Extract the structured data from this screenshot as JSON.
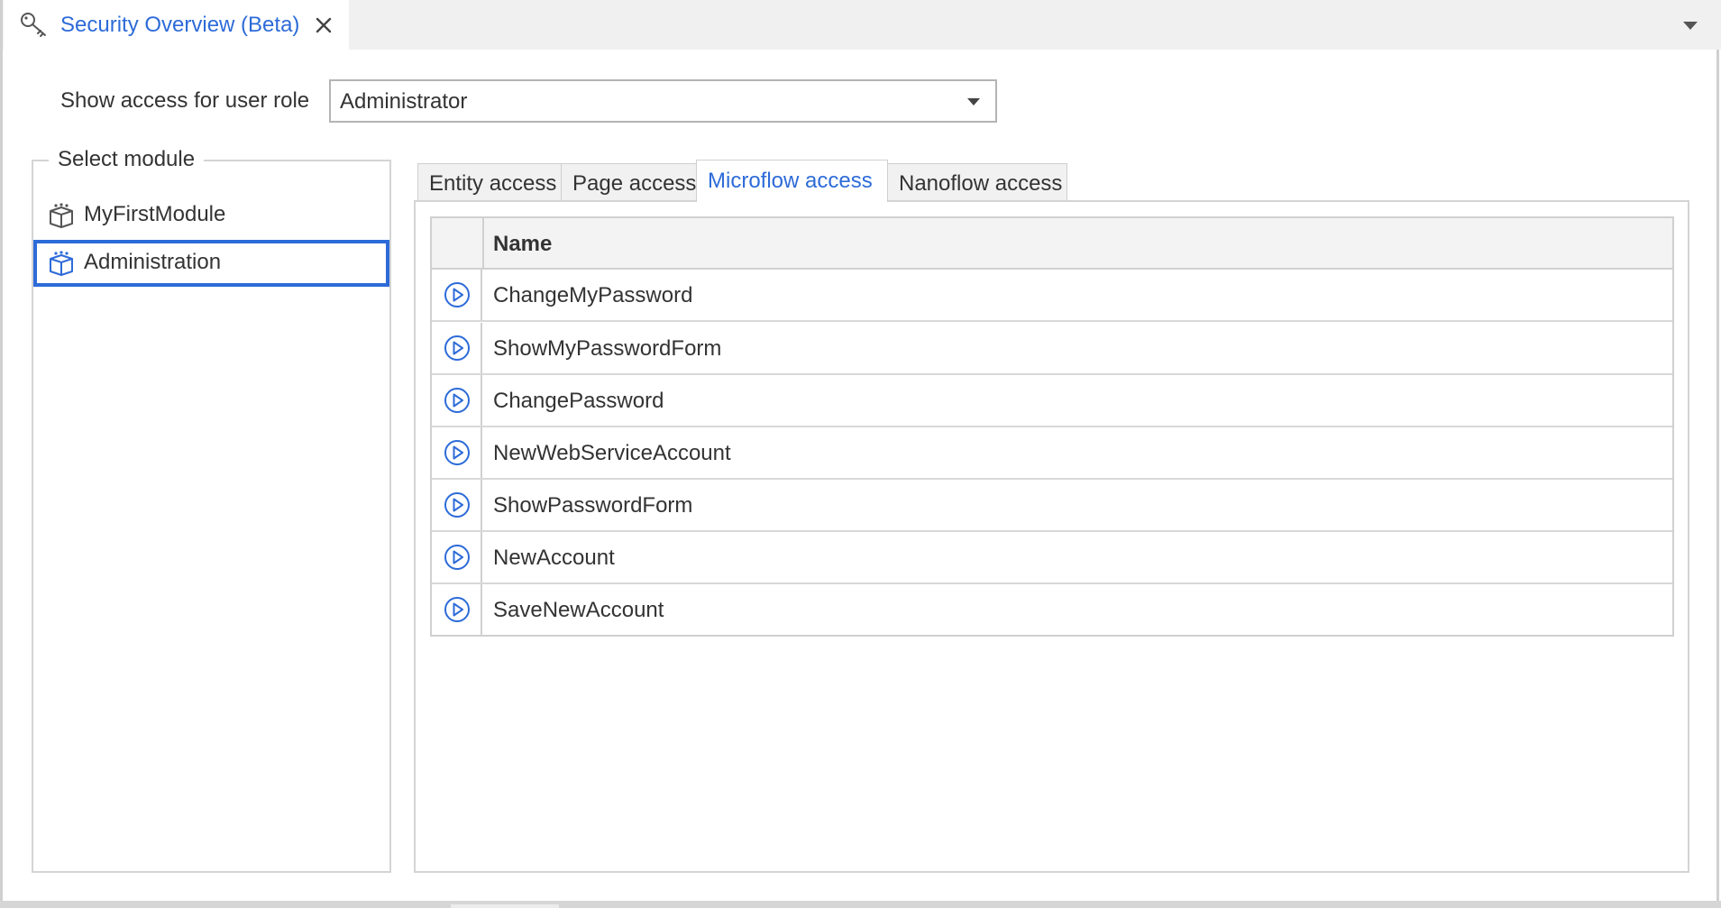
{
  "tab": {
    "title": "Security Overview (Beta)",
    "icon": "key-icon"
  },
  "role": {
    "label": "Show access for user role",
    "selected": "Administrator"
  },
  "modules": {
    "legend": "Select module",
    "items": [
      {
        "label": "MyFirstModule",
        "icon": "module-icon",
        "selected": false
      },
      {
        "label": "Administration",
        "icon": "module-icon",
        "selected": true
      }
    ]
  },
  "subtabs": [
    {
      "label": "Entity access",
      "active": false
    },
    {
      "label": "Page access",
      "active": false
    },
    {
      "label": "Microflow access",
      "active": true
    },
    {
      "label": "Nanoflow access",
      "active": false
    }
  ],
  "grid": {
    "header": "Name",
    "rows": [
      "ChangeMyPassword",
      "ShowMyPasswordForm",
      "ChangePassword",
      "NewWebServiceAccount",
      "ShowPasswordForm",
      "NewAccount",
      "SaveNewAccount"
    ]
  },
  "colors": {
    "accent": "#2d6bd8",
    "text": "#333333",
    "border": "#d0d0d0"
  }
}
